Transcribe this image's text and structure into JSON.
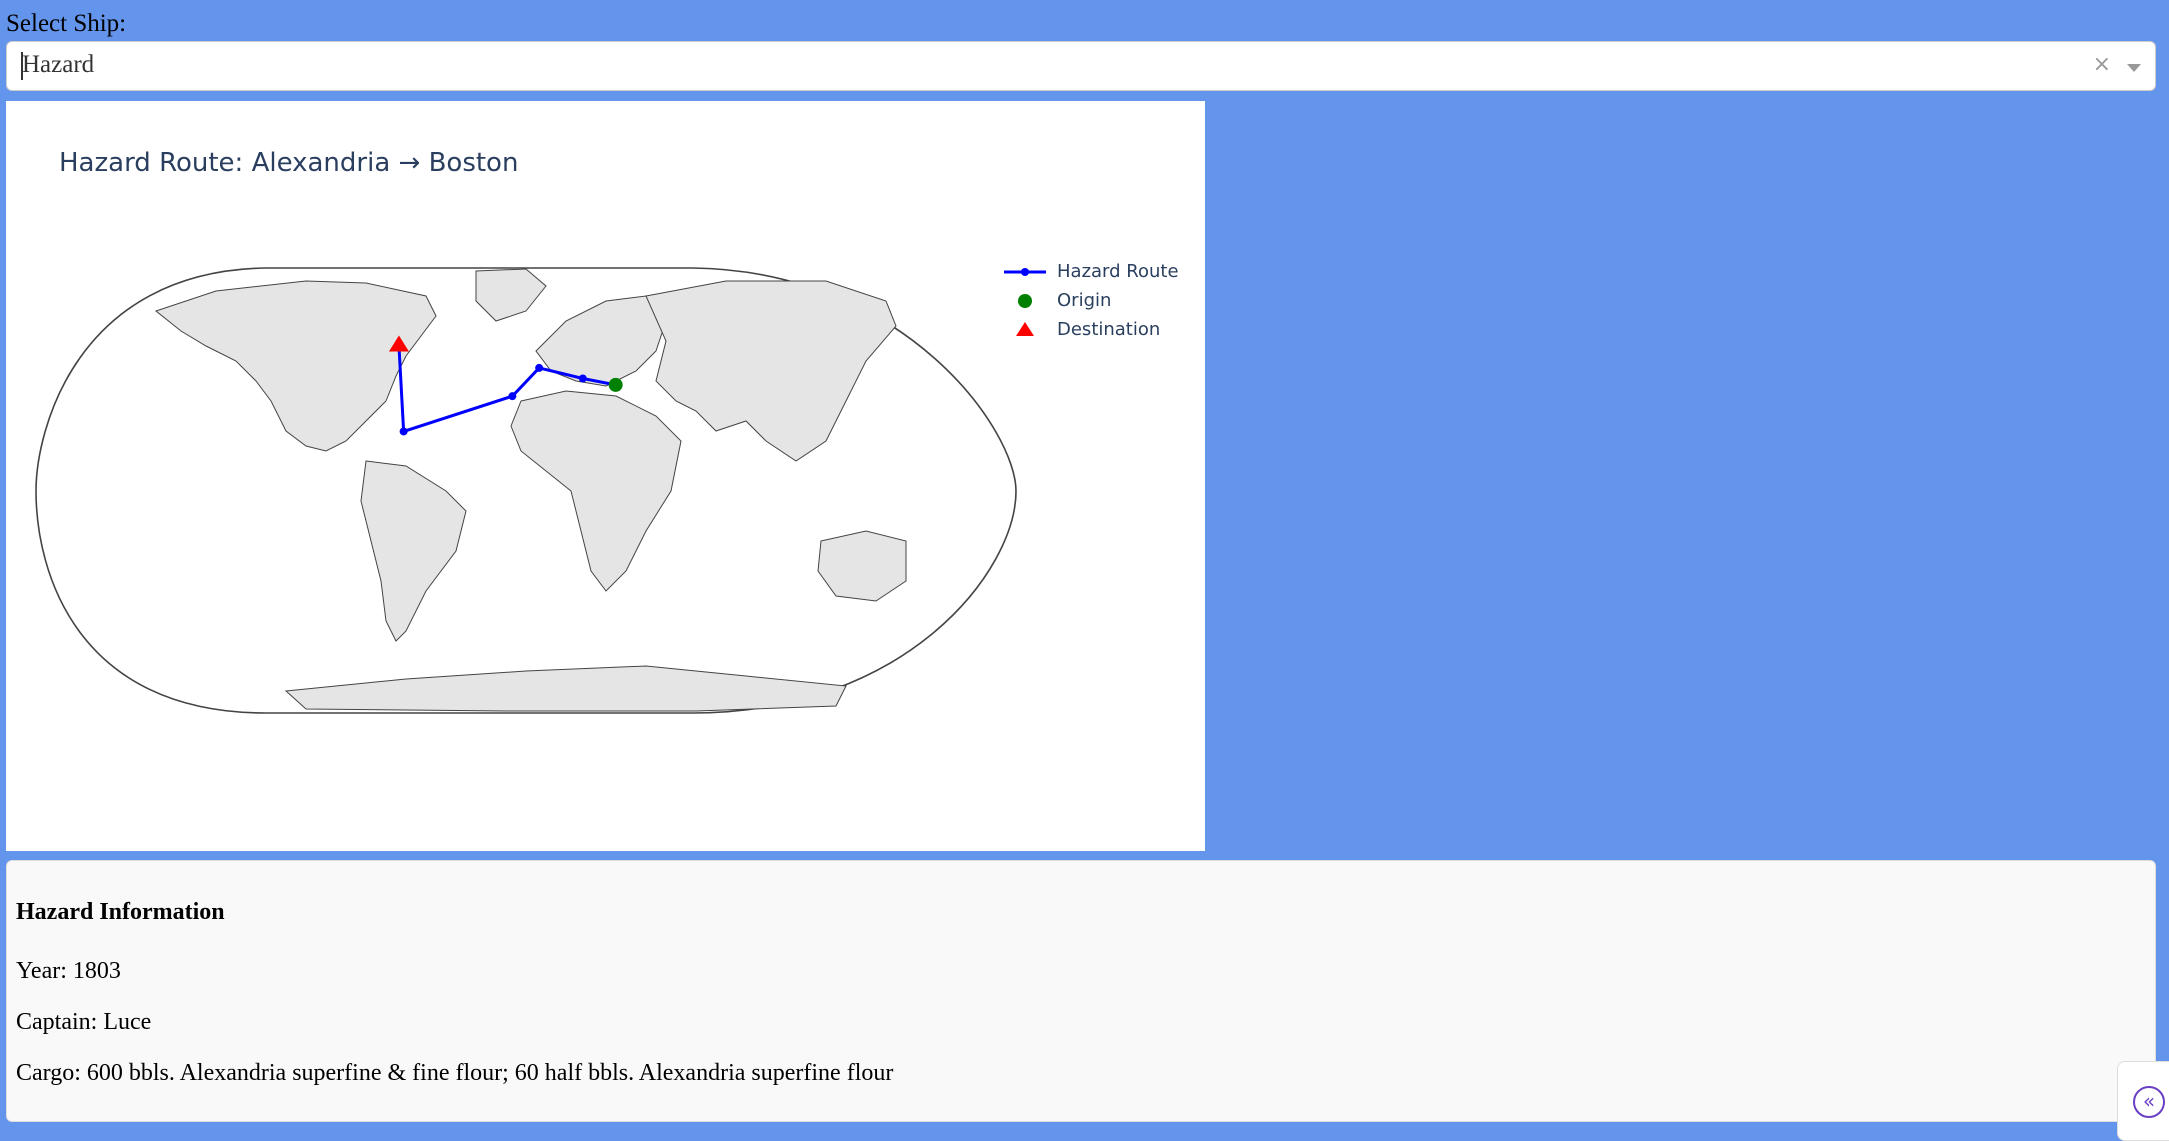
{
  "selector": {
    "label": "Select Ship:",
    "value": "Hazard",
    "clear_icon": "×"
  },
  "chart_data": {
    "type": "map",
    "title": "Hazard Route: Alexandria → Boston",
    "projection": "natural-earth",
    "route": {
      "name": "Hazard Route",
      "color": "#0000ff",
      "points": [
        {
          "lon": 29.9,
          "lat": 31.2
        },
        {
          "lon": 15.0,
          "lat": 33.0
        },
        {
          "lon": -5.0,
          "lat": 36.0
        },
        {
          "lon": -17.0,
          "lat": 28.0
        },
        {
          "lon": -65.0,
          "lat": 18.0
        },
        {
          "lon": -71.06,
          "lat": 42.36
        }
      ]
    },
    "origin": {
      "name": "Origin",
      "color": "#008000"
    },
    "destination": {
      "name": "Destination",
      "color": "#ff0000"
    },
    "legend": [
      "Hazard Route",
      "Origin",
      "Destination"
    ]
  },
  "info": {
    "heading": "Hazard Information",
    "year": "Year: 1803",
    "captain": "Captain: Luce",
    "cargo": "Cargo: 600 bbls. Alexandria superfine & fine flour; 60 half bbls. Alexandria superfine flour"
  },
  "side_toggle_icon": "chevrons-left-icon"
}
